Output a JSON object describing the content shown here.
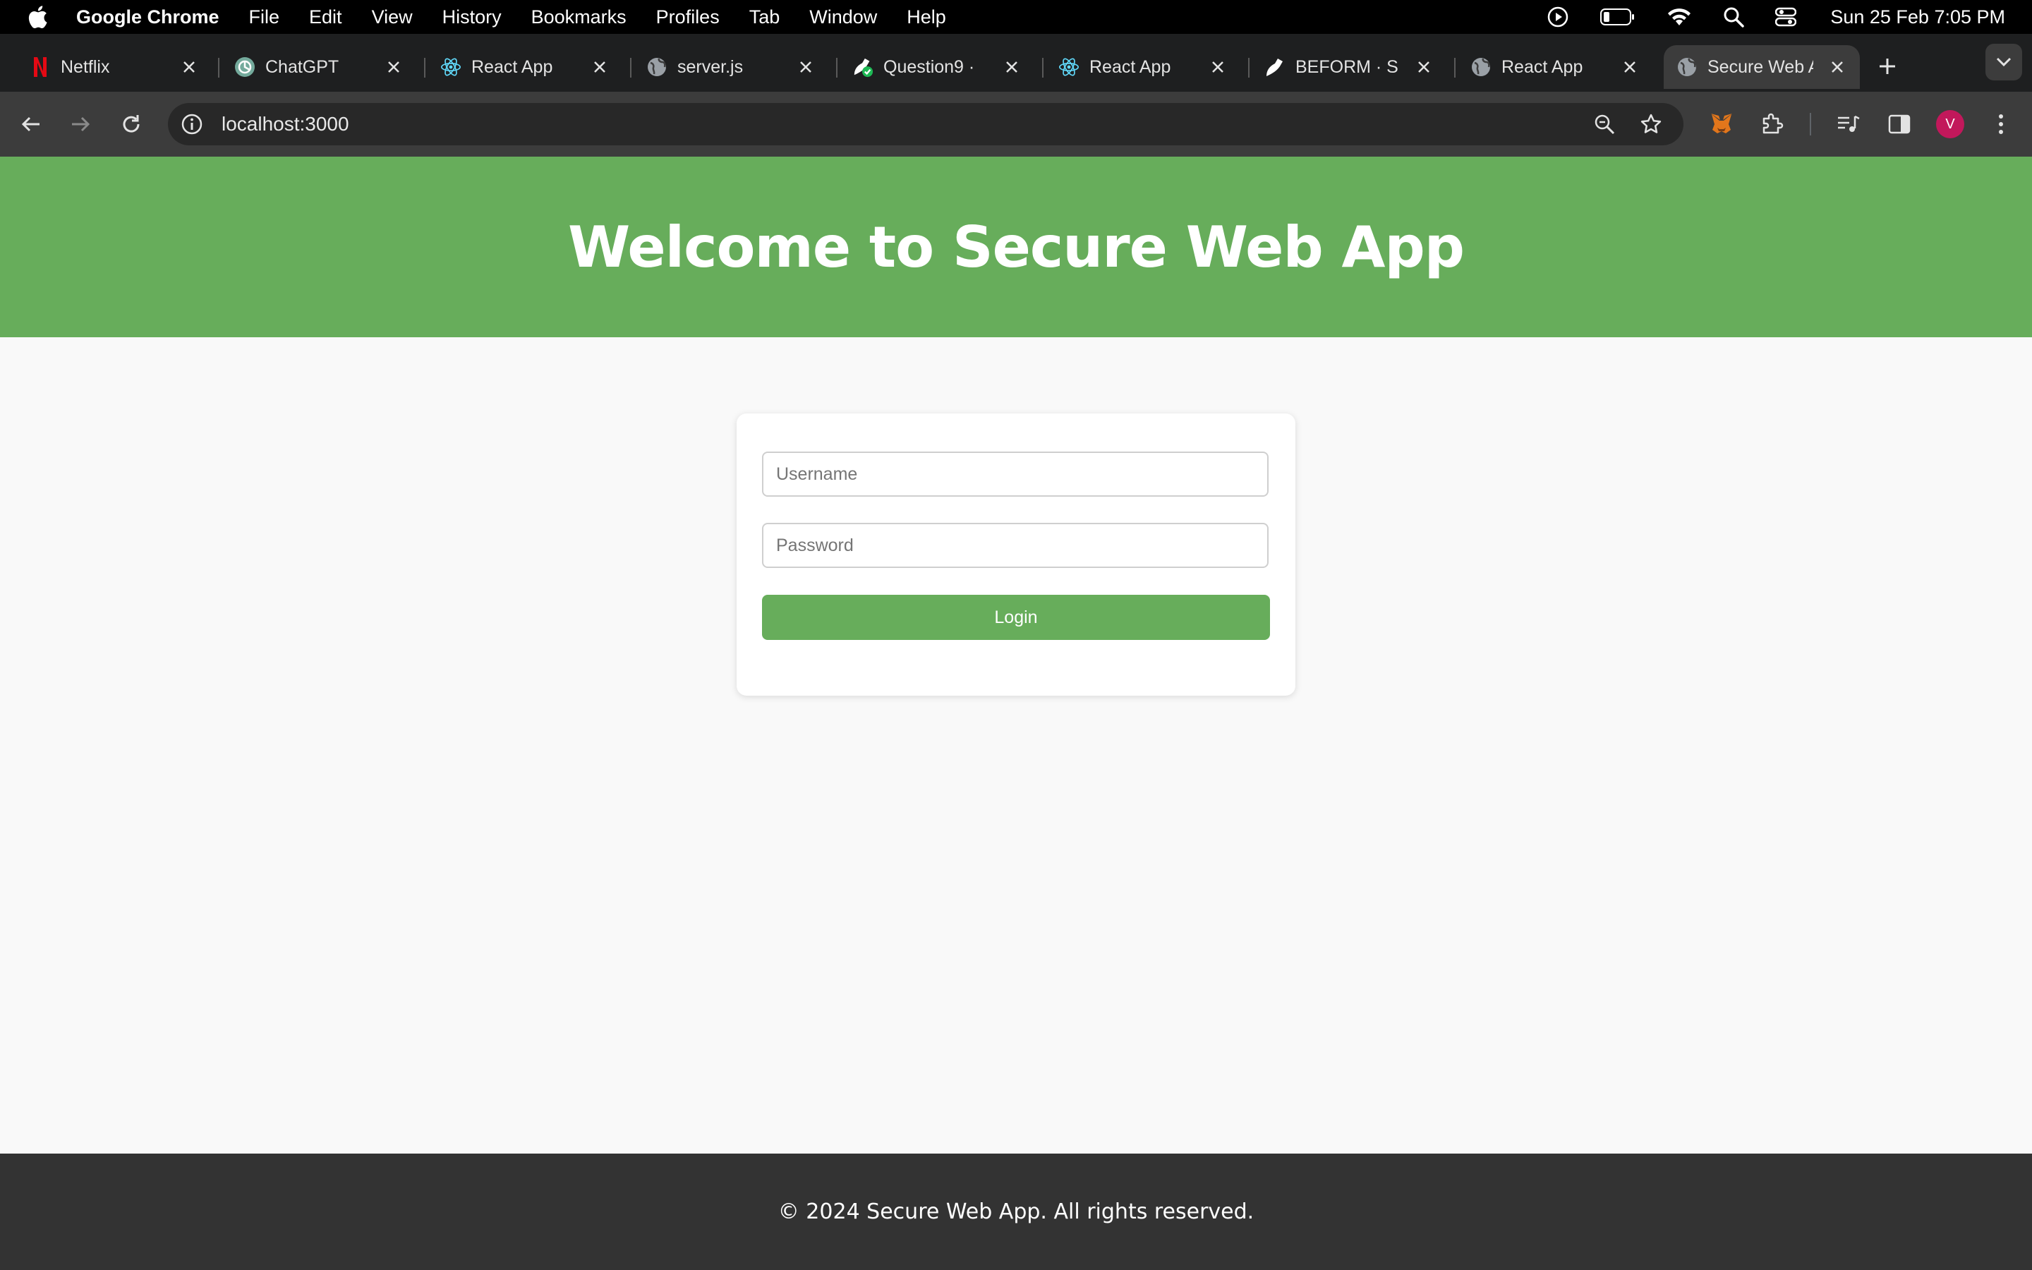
{
  "menubar": {
    "app_name": "Google Chrome",
    "items": [
      "File",
      "Edit",
      "View",
      "History",
      "Bookmarks",
      "Profiles",
      "Tab",
      "Window",
      "Help"
    ],
    "clock": "Sun 25 Feb  7:05 PM"
  },
  "tabs": [
    {
      "title": "Netflix",
      "icon": "netflix-icon"
    },
    {
      "title": "ChatGPT",
      "icon": "chatgpt-icon"
    },
    {
      "title": "React App",
      "icon": "react-icon"
    },
    {
      "title": "server.js",
      "icon": "globe-icon"
    },
    {
      "title": "Question9 ·",
      "icon": "edit-check-icon"
    },
    {
      "title": "React App",
      "icon": "react-icon"
    },
    {
      "title": "BEFORM · S",
      "icon": "beform-icon"
    },
    {
      "title": "React App",
      "icon": "globe-icon"
    },
    {
      "title": "Secure Web A",
      "icon": "globe-icon",
      "active": true
    }
  ],
  "toolbar": {
    "url": "localhost:3000",
    "avatar_letter": "V"
  },
  "page": {
    "title": "Welcome to Secure Web App",
    "login": {
      "username_placeholder": "Username",
      "password_placeholder": "Password",
      "button_label": "Login"
    },
    "footer": "© 2024 Secure Web App. All rights reserved."
  },
  "colors": {
    "accent_green": "#67ad5b",
    "footer_bg": "#333333",
    "page_bg": "#f9f9f9"
  }
}
